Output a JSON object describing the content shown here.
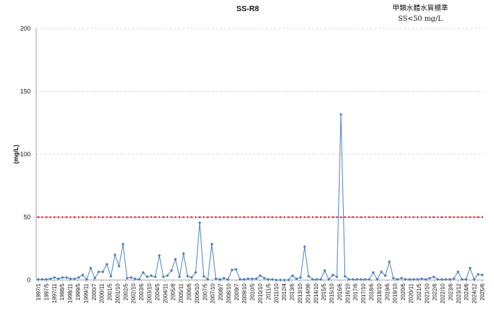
{
  "chart_data": {
    "type": "line",
    "title": "SS-R8",
    "standard_note": [
      "甲類水體水質標準",
      "SS<50 mg/L"
    ],
    "xlabel": "",
    "ylabel": "(mg/L)",
    "ylim": [
      0,
      200
    ],
    "yticks": [
      0,
      50,
      100,
      150,
      200
    ],
    "grid": true,
    "x_tick_labels": [
      "1997/1",
      "1997/5",
      "1997/11",
      "1998/5",
      "1998/11",
      "1999/5",
      "1999/11",
      "2000/7",
      "2000/11",
      "2001/5",
      "2001/10",
      "2002/5",
      "2002/10",
      "2003/6",
      "2003/10",
      "2004/5",
      "2004/11",
      "2005/8",
      "2005/11",
      "2006/6",
      "2006/10",
      "2007/5",
      "2007/10",
      "2008/7",
      "2008/10",
      "2009/7",
      "2009/10",
      "2010/5",
      "2010/10",
      "2011/5",
      "2011/10",
      "2012/4",
      "2013/6",
      "2013/10",
      "2014/06",
      "2014/10",
      "2015/5",
      "2015/10",
      "2016/6",
      "2016/10",
      "2017/6",
      "2017/10",
      "2018/6",
      "2018/10",
      "2019/6",
      "2019/10",
      "2020/6",
      "2020/11",
      "2021/5",
      "2021/10",
      "2022/6",
      "2022/10",
      "2023/6",
      "2023/12",
      "2024/6",
      "2024/12",
      "2025/6"
    ],
    "series": [
      {
        "name": "SS",
        "color": "#4a7ebb",
        "values": [
          0.5,
          0.5,
          0.5,
          1,
          2,
          1,
          2,
          2,
          1,
          1,
          2,
          4,
          0.5,
          9.5,
          1.5,
          6.5,
          6.5,
          12.5,
          3,
          20,
          11,
          28.5,
          1.5,
          2,
          1,
          0.5,
          6,
          2.5,
          3.5,
          2.5,
          19.5,
          2.5,
          3.5,
          7.5,
          16.5,
          2.5,
          21,
          3,
          2,
          6,
          45.5,
          3,
          0.5,
          28.5,
          1,
          0.5,
          1.5,
          0.5,
          8,
          8.5,
          0.5,
          0.5,
          1,
          1,
          1,
          3.5,
          1.5,
          0.5,
          0.5,
          0,
          0,
          0,
          0,
          3.5,
          1,
          2,
          26.5,
          3,
          0.5,
          0.5,
          0.5,
          7.5,
          0.5,
          4,
          2.5,
          131.5,
          3,
          0.5,
          0.5,
          0.5,
          0.5,
          0.5,
          0.5,
          6,
          0.5,
          6.5,
          3.5,
          14.5,
          1.5,
          0.5,
          1.5,
          0.5,
          0.5,
          0.5,
          0.5,
          1,
          0.5,
          1.5,
          2.5,
          0.5,
          0.5,
          0.5,
          0.5,
          1,
          6.5,
          0.5,
          0.5,
          9.5,
          0.5,
          4.5,
          4
        ]
      },
      {
        "name": "SS<50 mg/L",
        "color": "#e02020",
        "constant": 50
      }
    ]
  }
}
